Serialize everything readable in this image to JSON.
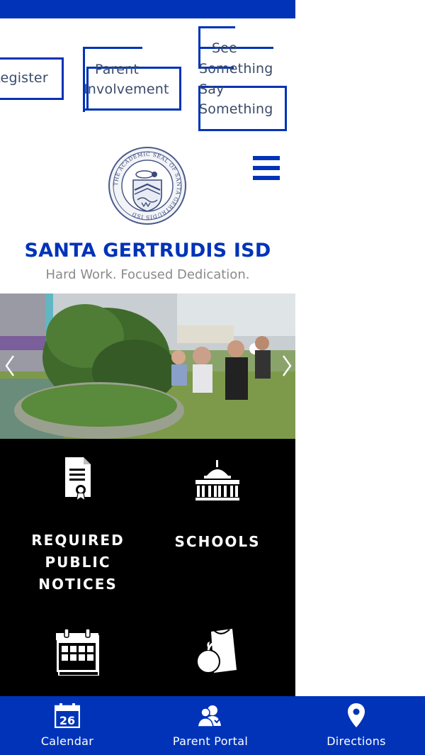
{
  "quick_links": {
    "register": "Register",
    "parent_involvement_line1": "Parent",
    "parent_involvement_line2": "Involvement",
    "see_something_line1": "See",
    "see_something_line2": "Something",
    "see_something_line3": "Say",
    "see_something_line4": "Something"
  },
  "header": {
    "title": "SANTA GERTRUDIS ISD",
    "tagline": "Hard Work. Focused Dedication.",
    "seal_text": "THE ACADEMIC SEAL OF SANTA GERTRUDIS ISD"
  },
  "tiles": [
    {
      "label_lines": [
        "REQUIRED",
        "PUBLIC",
        "NOTICES"
      ],
      "icon": "certificate-document-icon"
    },
    {
      "label_lines": [
        "SCHOOLS"
      ],
      "icon": "school-building-icon"
    },
    {
      "label_lines": [],
      "icon": "calendar-icon"
    },
    {
      "label_lines": [],
      "icon": "lunch-bag-apple-icon"
    }
  ],
  "bottom_nav": {
    "calendar_label": "Calendar",
    "calendar_day": "26",
    "parent_portal_label": "Parent Portal",
    "directions_label": "Directions"
  },
  "colors": {
    "brand_blue": "#0033b8",
    "tile_background": "#000000",
    "tagline_gray": "#8a8a8a"
  }
}
